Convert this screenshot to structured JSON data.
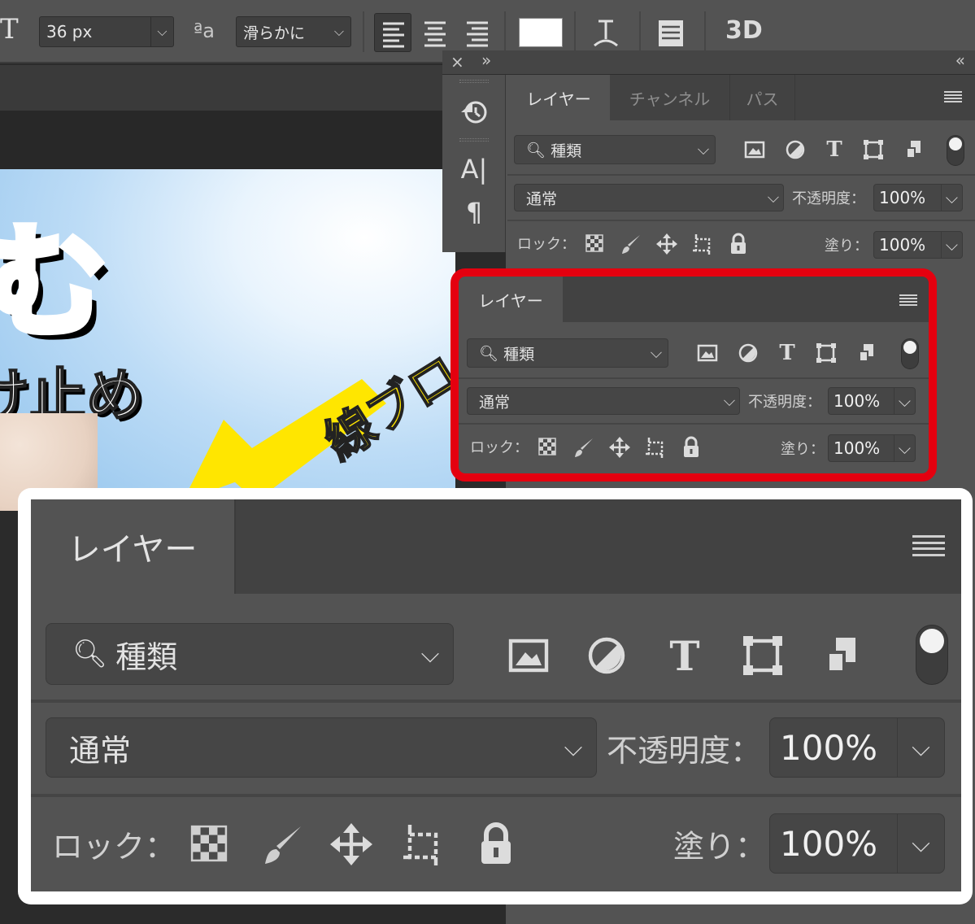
{
  "options_bar": {
    "type_tool_glyph": "T",
    "font_size": "36 px",
    "aa_icon_text": "ªa",
    "antialias": "滑らかに",
    "three_d": "3D",
    "text_color": "#ffffff"
  },
  "document": {
    "thumbnail_text_1": "む",
    "thumbnail_text_2": "け止め",
    "thumbnail_text_3": "線ブロ"
  },
  "tools_panel": {
    "items": [
      "history-icon",
      "character-icon",
      "paragraph-icon"
    ],
    "character_glyph": "A|",
    "paragraph_glyph": "¶"
  },
  "dock": {
    "close_glyph": "×",
    "expand_glyph": "»",
    "collapse_glyph": "«"
  },
  "layers_panel_full": {
    "tabs": [
      "レイヤー",
      "チャンネル",
      "パス"
    ],
    "filter_kind": "種類",
    "blend_mode": "通常",
    "opacity_label": "不透明度：",
    "opacity_value": "100%",
    "lock_label": "ロック：",
    "fill_label": "塗り：",
    "fill_value": "100%"
  },
  "layers_panel_highlight": {
    "tab": "レイヤー",
    "filter_kind": "種類",
    "blend_mode": "通常",
    "opacity_label": "不透明度：",
    "opacity_value": "100%",
    "lock_label": "ロック：",
    "fill_label": "塗り：",
    "fill_value": "100%"
  },
  "layers_panel_zoom": {
    "tab": "レイヤー",
    "filter_kind": "種類",
    "blend_mode": "通常",
    "opacity_label": "不透明度：",
    "opacity_value": "100%",
    "lock_label": "ロック：",
    "fill_label": "塗り：",
    "fill_value": "100%"
  },
  "colors": {
    "highlight_border": "#e4000f",
    "panel_bg": "#535353",
    "tab_strip": "#424242"
  }
}
